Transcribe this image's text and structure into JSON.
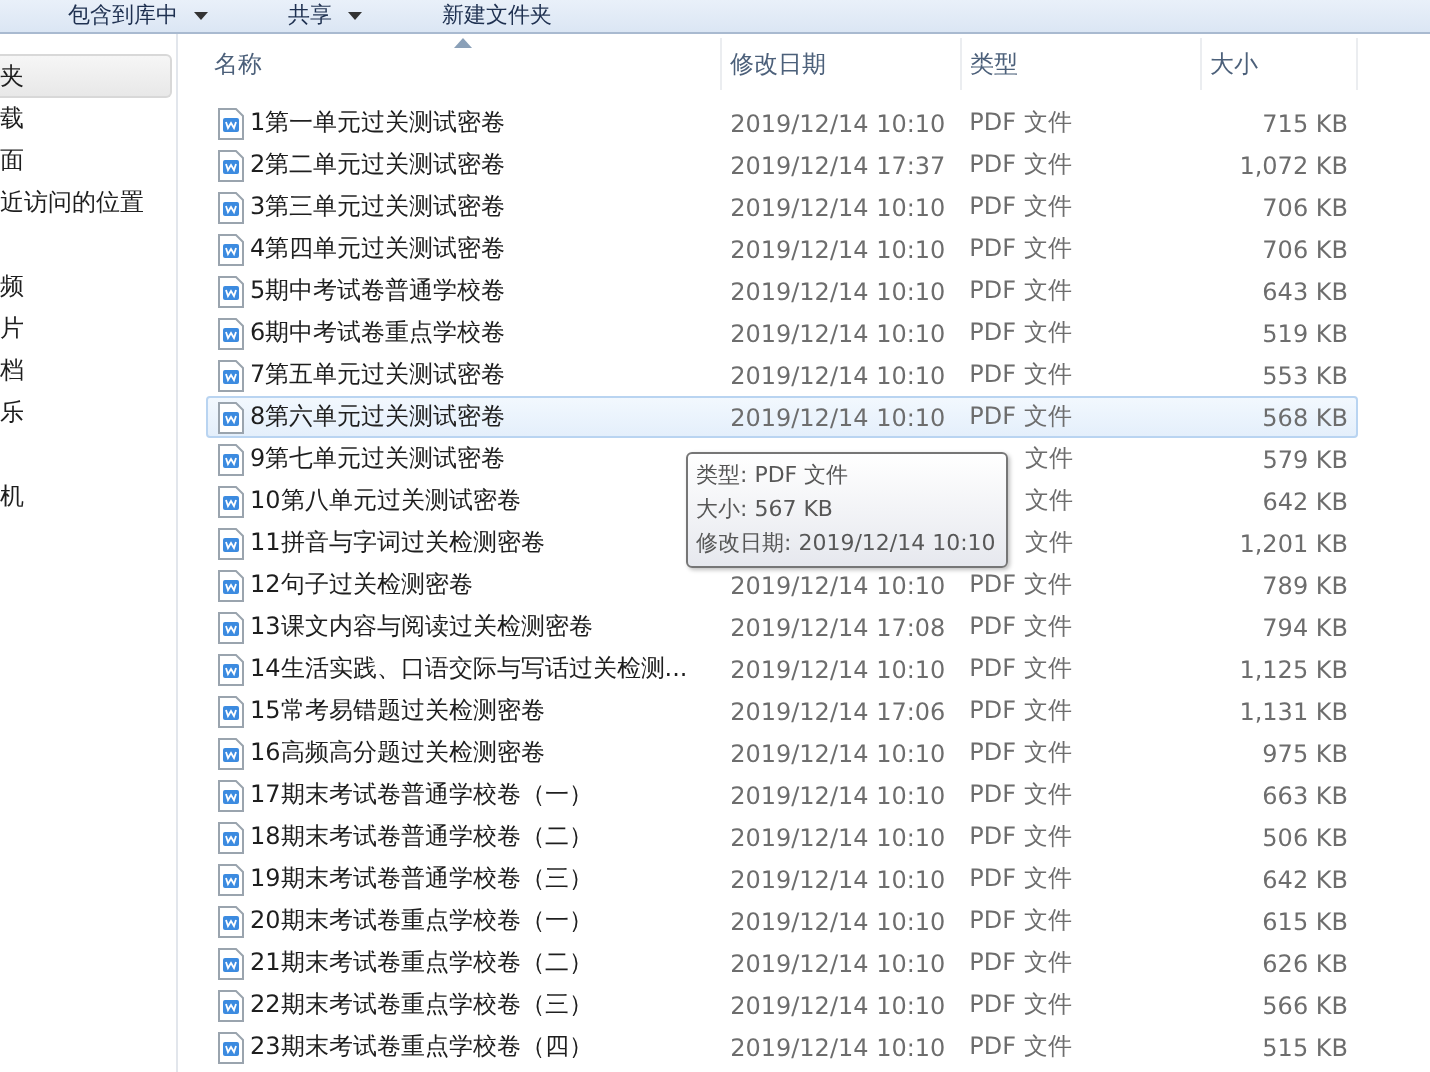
{
  "toolbar": {
    "buttons": [
      {
        "label": "包含到库中",
        "dropdown": true
      },
      {
        "label": "共享",
        "dropdown": true
      },
      {
        "label": "新建文件夹",
        "dropdown": false
      }
    ]
  },
  "sidebar": {
    "groups": [
      {
        "items": [
          {
            "label": "夹",
            "selected": true
          },
          {
            "label": "载",
            "selected": false
          },
          {
            "label": "面",
            "selected": false
          },
          {
            "label": "近访问的位置",
            "selected": false
          }
        ]
      },
      {
        "items": [
          {
            "label": "频",
            "selected": false
          },
          {
            "label": "片",
            "selected": false
          },
          {
            "label": "档",
            "selected": false
          },
          {
            "label": "乐",
            "selected": false
          }
        ]
      },
      {
        "items": [
          {
            "label": "机",
            "selected": false
          }
        ]
      }
    ]
  },
  "table": {
    "columns": [
      "名称",
      "修改日期",
      "类型",
      "大小"
    ],
    "rows": [
      {
        "name": "1第一单元过关测试密卷",
        "date": "2019/12/14 10:10",
        "type": "PDF 文件",
        "size": "715 KB",
        "hovered": false
      },
      {
        "name": "2第二单元过关测试密卷",
        "date": "2019/12/14 17:37",
        "type": "PDF 文件",
        "size": "1,072 KB",
        "hovered": false
      },
      {
        "name": "3第三单元过关测试密卷",
        "date": "2019/12/14 10:10",
        "type": "PDF 文件",
        "size": "706 KB",
        "hovered": false
      },
      {
        "name": "4第四单元过关测试密卷",
        "date": "2019/12/14 10:10",
        "type": "PDF 文件",
        "size": "706 KB",
        "hovered": false
      },
      {
        "name": "5期中考试卷普通学校卷",
        "date": "2019/12/14 10:10",
        "type": "PDF 文件",
        "size": "643 KB",
        "hovered": false
      },
      {
        "name": "6期中考试卷重点学校卷",
        "date": "2019/12/14 10:10",
        "type": "PDF 文件",
        "size": "519 KB",
        "hovered": false
      },
      {
        "name": "7第五单元过关测试密卷",
        "date": "2019/12/14 10:10",
        "type": "PDF 文件",
        "size": "553 KB",
        "hovered": false
      },
      {
        "name": "8第六单元过关测试密卷",
        "date": "2019/12/14 10:10",
        "type": "PDF 文件",
        "size": "568 KB",
        "hovered": true
      },
      {
        "name": "9第七单元过关测试密卷",
        "type": "文件",
        "size": "579 KB",
        "hovered": false
      },
      {
        "name": "10第八单元过关测试密卷",
        "type": "文件",
        "size": "642 KB",
        "hovered": false
      },
      {
        "name": "11拼音与字词过关检测密卷",
        "type": "文件",
        "size": "1,201 KB",
        "hovered": false
      },
      {
        "name": "12句子过关检测密卷",
        "date": "2019/12/14 10:10",
        "type": "PDF 文件",
        "size": "789 KB",
        "hovered": false
      },
      {
        "name": "13课文内容与阅读过关检测密卷",
        "date": "2019/12/14 17:08",
        "type": "PDF 文件",
        "size": "794 KB",
        "hovered": false
      },
      {
        "name": "14生活实践、口语交际与写话过关检测...",
        "date": "2019/12/14 10:10",
        "type": "PDF 文件",
        "size": "1,125 KB",
        "hovered": false
      },
      {
        "name": "15常考易错题过关检测密卷",
        "date": "2019/12/14 17:06",
        "type": "PDF 文件",
        "size": "1,131 KB",
        "hovered": false
      },
      {
        "name": "16高频高分题过关检测密卷",
        "date": "2019/12/14 10:10",
        "type": "PDF 文件",
        "size": "975 KB",
        "hovered": false
      },
      {
        "name": "17期末考试卷普通学校卷（一）",
        "date": "2019/12/14 10:10",
        "type": "PDF 文件",
        "size": "663 KB",
        "hovered": false
      },
      {
        "name": "18期末考试卷普通学校卷（二）",
        "date": "2019/12/14 10:10",
        "type": "PDF 文件",
        "size": "506 KB",
        "hovered": false
      },
      {
        "name": "19期末考试卷普通学校卷（三）",
        "date": "2019/12/14 10:10",
        "type": "PDF 文件",
        "size": "642 KB",
        "hovered": false
      },
      {
        "name": "20期末考试卷重点学校卷（一）",
        "date": "2019/12/14 10:10",
        "type": "PDF 文件",
        "size": "615 KB",
        "hovered": false
      },
      {
        "name": "21期末考试卷重点学校卷（二）",
        "date": "2019/12/14 10:10",
        "type": "PDF 文件",
        "size": "626 KB",
        "hovered": false
      },
      {
        "name": "22期末考试卷重点学校卷（三）",
        "date": "2019/12/14 10:10",
        "type": "PDF 文件",
        "size": "566 KB",
        "hovered": false
      },
      {
        "name": "23期末考试卷重点学校卷（四）",
        "date": "2019/12/14 10:10",
        "type": "PDF 文件",
        "size": "515 KB",
        "hovered": false
      }
    ]
  },
  "tooltip": {
    "lines": [
      "类型: PDF 文件",
      "大小: 567 KB",
      "修改日期: 2019/12/14 10:10"
    ]
  }
}
